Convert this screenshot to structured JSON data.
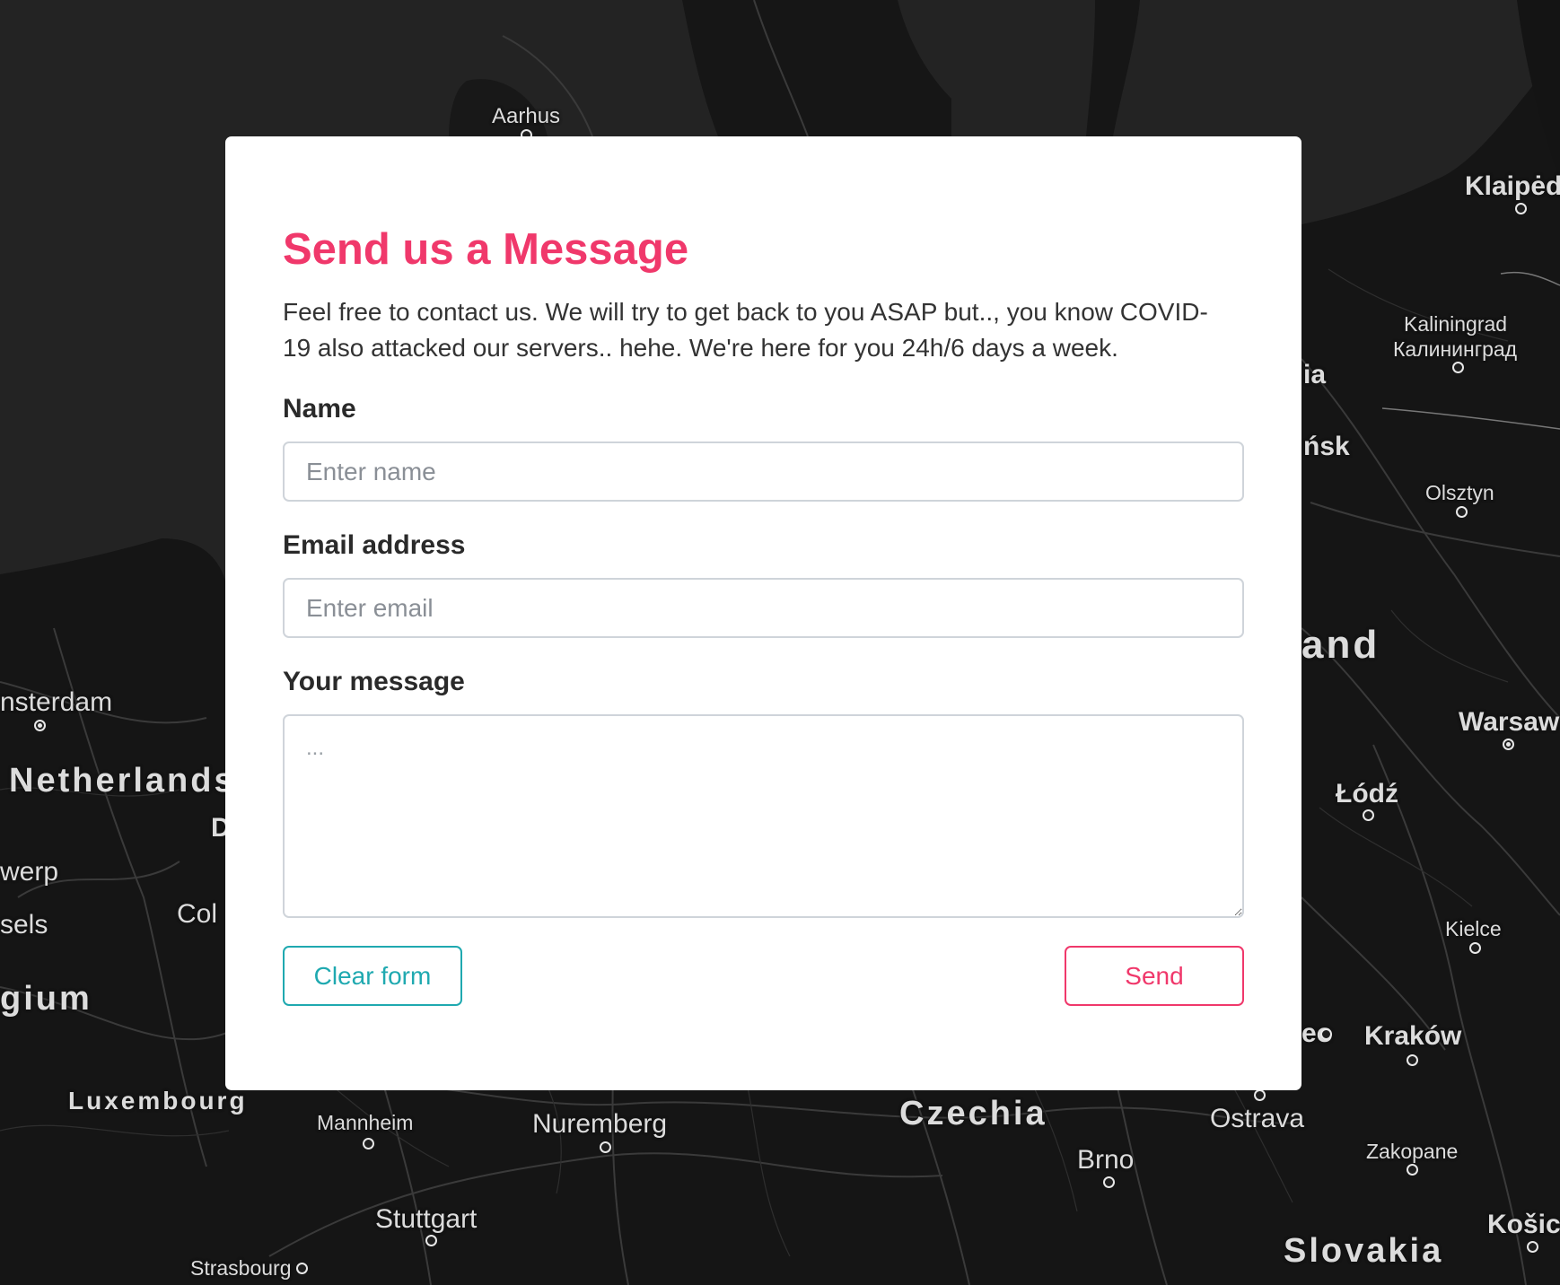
{
  "form": {
    "title": "Send us a Message",
    "intro": "Feel free to contact us. We will try to get back to you ASAP but.., you know COVID-19 also attacked our servers.. hehe. We're here for you 24h/6 days a week.",
    "name_label": "Name",
    "name_placeholder": "Enter name",
    "email_label": "Email address",
    "email_placeholder": "Enter email",
    "message_label": "Your message",
    "message_placeholder": "...",
    "clear_label": "Clear form",
    "send_label": "Send"
  },
  "map": {
    "places": {
      "aarhus": "Aarhus",
      "klaipeda": "Klaipėd",
      "kaliningrad": "Kaliningrad",
      "kaliningrad_ru": "Калининград",
      "ia_fragment": "ia",
      "nsk_fragment": "ńsk",
      "olsztyn": "Olsztyn",
      "and_fragment": "and",
      "amsterdam": "nsterdam",
      "netherlands": "Netherlands",
      "d_fragment": "D",
      "warsaw": "Warsaw",
      "lodz": "Łódź",
      "antwerp": "werp",
      "brussels": "sels",
      "cologne": "Col",
      "kielce": "Kielce",
      "belgium": "gium",
      "krakow": "Kraków",
      "eo_fragment": "eo",
      "luxembourg": "Luxembourg",
      "mannheim": "Mannheim",
      "nuremberg": "Nuremberg",
      "czechia": "Czechia",
      "ostrava": "Ostrava",
      "zakopane": "Zakopane",
      "brno": "Brno",
      "stuttgart": "Stuttgart",
      "strasbourg": "Strasbourg",
      "slovakia": "Slovakia",
      "kosice": "Košic"
    }
  }
}
